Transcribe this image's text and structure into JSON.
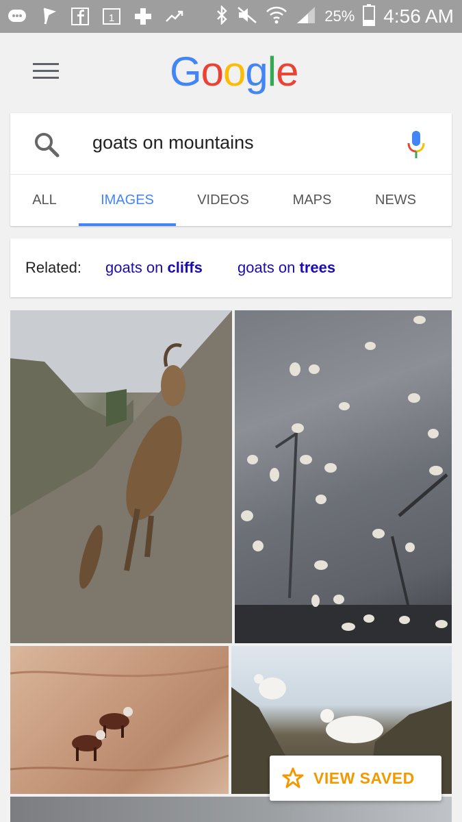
{
  "status_bar": {
    "battery_percent": "25%",
    "time": "4:56 AM",
    "icons": [
      "chat-icon",
      "flag-icon",
      "facebook-icon",
      "calendar-icon",
      "health-cross-icon",
      "trend-icon",
      "bluetooth-icon",
      "mute-icon",
      "wifi-icon",
      "signal-icon",
      "battery-icon"
    ]
  },
  "header": {
    "logo": "Google",
    "logo_colors": [
      "#4285f4",
      "#ea4335",
      "#fbbc05",
      "#4285f4",
      "#34a853",
      "#ea4335"
    ]
  },
  "search": {
    "query": "goats on mountains"
  },
  "tabs": [
    {
      "label": "ALL",
      "active": false
    },
    {
      "label": "IMAGES",
      "active": true
    },
    {
      "label": "VIDEOS",
      "active": false
    },
    {
      "label": "MAPS",
      "active": false
    },
    {
      "label": "NEWS",
      "active": false
    }
  ],
  "related": {
    "label": "Related:",
    "links": [
      {
        "prefix": "goats on ",
        "bold": "cliffs"
      },
      {
        "prefix": "goats on ",
        "bold": "trees"
      }
    ]
  },
  "images": [
    {
      "subject": "ibex-climbing-cliff"
    },
    {
      "subject": "many-goats-on-rock-face"
    },
    {
      "subject": "brown-goats-on-rock"
    },
    {
      "subject": "mountain-goats-on-ridge"
    },
    {
      "subject": "partial-image"
    }
  ],
  "view_saved": {
    "label": "VIEW SAVED",
    "color": "#f29900"
  },
  "colors": {
    "accent": "#4285f4",
    "link": "#1a0dab"
  }
}
